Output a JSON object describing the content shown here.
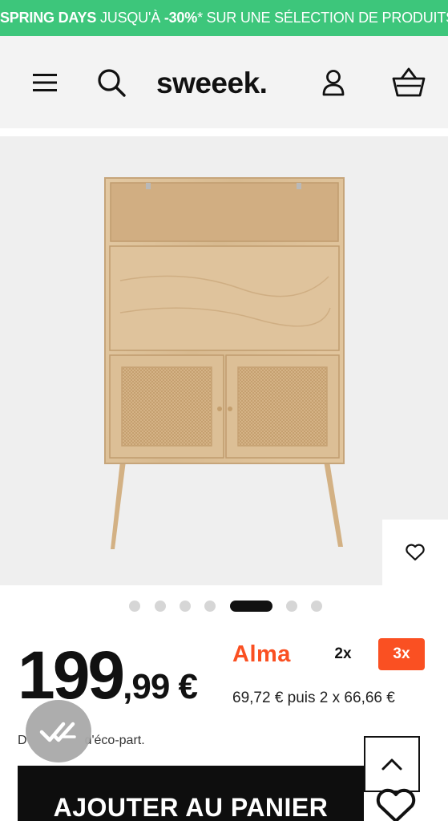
{
  "promo": {
    "bold1": "SPRING DAYS",
    "text1": " JUSQU'À ",
    "bold2": "-30%",
    "text2": "* SUR UNE SÉLECTION DE PRODUITS"
  },
  "header": {
    "logo": "sweeek.",
    "icons": [
      "menu-icon",
      "search-icon",
      "account-icon",
      "basket-icon"
    ]
  },
  "gallery": {
    "image": "furniture-secretary-desk",
    "slide_count": 7,
    "active_slide": 5
  },
  "product": {
    "price_int": "199",
    "price_dec": ",99 €"
  },
  "alma": {
    "brand": "Alma",
    "option_2x": "2x",
    "option_3x": "3x",
    "schedule": "69,72 € puis 2 x 66,66 €"
  },
  "eco": {
    "text_start": "D",
    "text_end": "d'éco-part."
  },
  "actions": {
    "add_to_cart": "AJOUTER AU PANIER"
  },
  "colors": {
    "promo_bg": "#3dc67b",
    "alma_orange": "#fa5022",
    "button_dark": "#0e0e0e"
  }
}
